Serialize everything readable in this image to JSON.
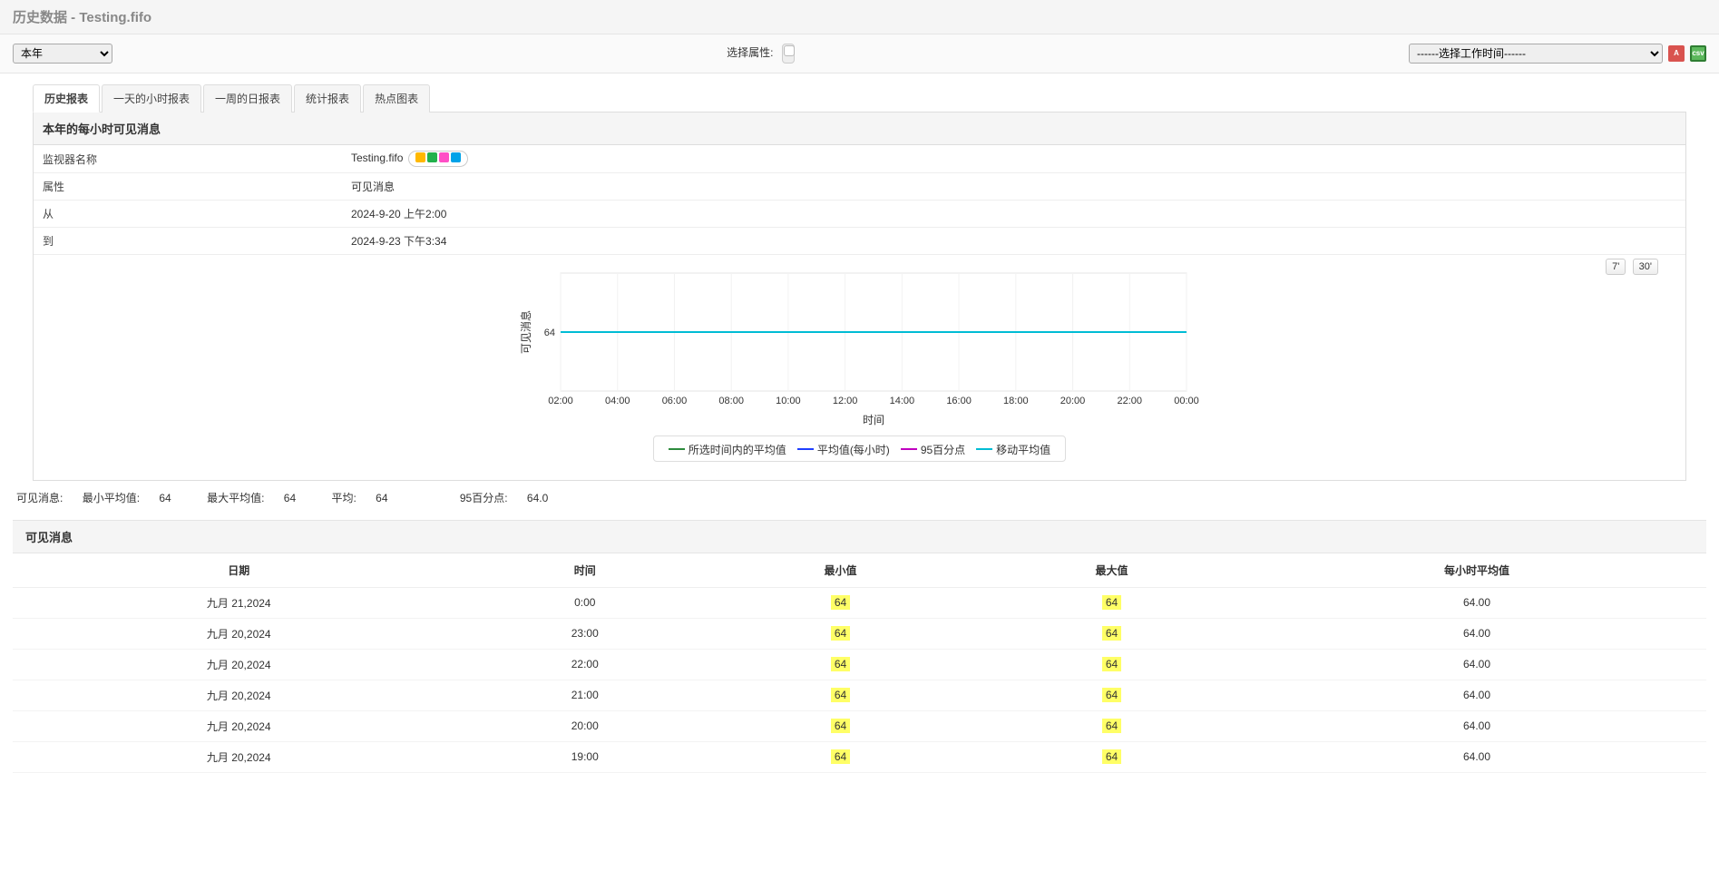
{
  "header": {
    "title": "历史数据 - Testing.fifo"
  },
  "toolbar": {
    "period_select": "本年",
    "attr_label": "选择属性:",
    "worktime_select": "------选择工作时间------"
  },
  "tabs": [
    {
      "label": "历史报表",
      "active": true
    },
    {
      "label": "一天的小时报表",
      "active": false
    },
    {
      "label": "一周的日报表",
      "active": false
    },
    {
      "label": "统计报表",
      "active": false
    },
    {
      "label": "热点图表",
      "active": false
    }
  ],
  "panel": {
    "title": "本年的每小时可见消息"
  },
  "meta": [
    {
      "k": "监视器名称",
      "v": "Testing.fifo",
      "icons": true
    },
    {
      "k": "属性",
      "v": "可见消息"
    },
    {
      "k": "从",
      "v": "2024-9-20 上午2:00"
    },
    {
      "k": "到",
      "v": "2024-9-23 下午3:34"
    }
  ],
  "zoom": {
    "a": "7'",
    "b": "30'"
  },
  "chart_data": {
    "type": "line",
    "title": "",
    "xlabel": "时间",
    "ylabel": "可见消息",
    "x_ticks": [
      "02:00",
      "04:00",
      "06:00",
      "08:00",
      "10:00",
      "12:00",
      "14:00",
      "16:00",
      "18:00",
      "20:00",
      "22:00",
      "00:00"
    ],
    "y_ticks": [
      64
    ],
    "ylim": [
      60,
      68
    ],
    "series": [
      {
        "name": "所选时间内的平均值",
        "color": "#2e8b3d",
        "values": [
          64,
          64,
          64,
          64,
          64,
          64,
          64,
          64,
          64,
          64,
          64,
          64
        ]
      },
      {
        "name": "平均值(每小时)",
        "color": "#1f3fff",
        "values": [
          64,
          64,
          64,
          64,
          64,
          64,
          64,
          64,
          64,
          64,
          64,
          64
        ]
      },
      {
        "name": "95百分点",
        "color": "#c000c0",
        "values": [
          64,
          64,
          64,
          64,
          64,
          64,
          64,
          64,
          64,
          64,
          64,
          64
        ]
      },
      {
        "name": "移动平均值",
        "color": "#00bcd4",
        "values": [
          64,
          64,
          64,
          64,
          64,
          64,
          64,
          64,
          64,
          64,
          64,
          64
        ]
      }
    ]
  },
  "stats": {
    "label": "可见消息:",
    "min_label": "最小平均值:",
    "min": "64",
    "max_label": "最大平均值:",
    "max": "64",
    "avg_label": "平均:",
    "avg": "64",
    "p95_label": "95百分点:",
    "p95": "64.0"
  },
  "table": {
    "title": "可见消息",
    "columns": [
      "日期",
      "时间",
      "最小值",
      "最大值",
      "每小时平均值"
    ],
    "rows": [
      {
        "date": "九月 21,2024",
        "time": "0:00",
        "min": "64",
        "max": "64",
        "avg": "64.00"
      },
      {
        "date": "九月 20,2024",
        "time": "23:00",
        "min": "64",
        "max": "64",
        "avg": "64.00"
      },
      {
        "date": "九月 20,2024",
        "time": "22:00",
        "min": "64",
        "max": "64",
        "avg": "64.00"
      },
      {
        "date": "九月 20,2024",
        "time": "21:00",
        "min": "64",
        "max": "64",
        "avg": "64.00"
      },
      {
        "date": "九月 20,2024",
        "time": "20:00",
        "min": "64",
        "max": "64",
        "avg": "64.00"
      },
      {
        "date": "九月 20,2024",
        "time": "19:00",
        "min": "64",
        "max": "64",
        "avg": "64.00"
      }
    ]
  }
}
